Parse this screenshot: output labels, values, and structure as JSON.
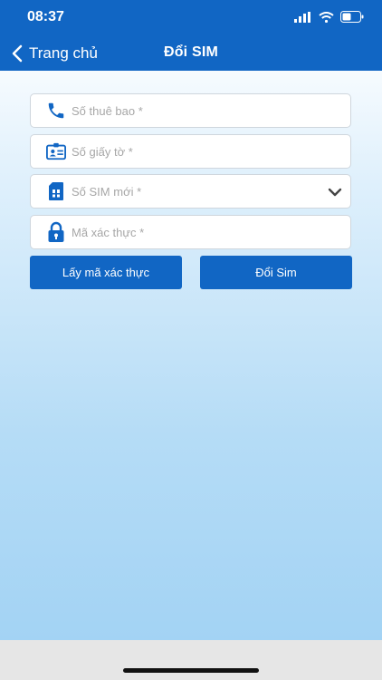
{
  "status_bar": {
    "time": "08:37",
    "icons": [
      "cellular-signal-icon",
      "wifi-icon",
      "battery-icon"
    ]
  },
  "header": {
    "back_label": "Trang chủ",
    "title": "Đổi SIM"
  },
  "form": {
    "phone_placeholder": "Số thuê bao *",
    "id_placeholder": "Số giấy tờ *",
    "sim_placeholder": "Số SIM mới *",
    "otp_placeholder": "Mã xác thực *"
  },
  "buttons": {
    "get_code": "Lấy mã xác thực",
    "change_sim": "Đổi Sim"
  },
  "colors": {
    "header_bg": "#1166c4",
    "button_bg": "#1166c4",
    "icon": "#1166c4"
  }
}
